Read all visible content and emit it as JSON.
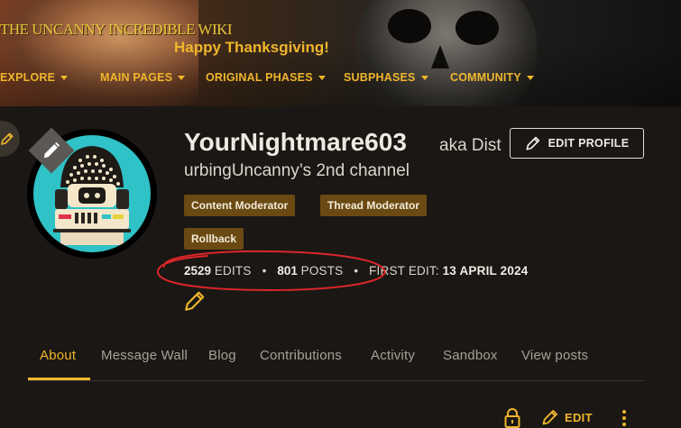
{
  "header": {
    "wiki_name": "THE UNCANNY INCREDIBLE WIKI",
    "tagline": "Happy Thanksgiving!",
    "nav": [
      {
        "label": "EXPLORE",
        "icon": "chevron-down-icon"
      },
      {
        "label": "MAIN PAGES",
        "icon": "chevron-down-icon"
      },
      {
        "label": "ORIGINAL PHASES",
        "icon": "chevron-down-icon"
      },
      {
        "label": "SUBPHASES",
        "icon": "chevron-down-icon"
      },
      {
        "label": "COMMUNITY",
        "icon": "chevron-down-icon"
      }
    ]
  },
  "profile": {
    "username": "YourNightmare603",
    "aka_prefix": "aka Dist",
    "aka_rest": "urbingUncanny’s 2nd channel",
    "edit_profile_label": "EDIT PROFILE",
    "badges": [
      "Content Moderator",
      "Thread Moderator",
      "Rollback"
    ],
    "stats": {
      "edits_count": "2529",
      "edits_label": "EDITS",
      "posts_count": "801",
      "posts_label": "POSTS",
      "first_edit_label": "FIRST EDIT:",
      "first_edit_date": "13 APRIL 2024",
      "separator": "•"
    }
  },
  "tabs": [
    {
      "label": "About",
      "active": true
    },
    {
      "label": "Message Wall",
      "active": false
    },
    {
      "label": "Blog",
      "active": false
    },
    {
      "label": "Contributions",
      "active": false
    },
    {
      "label": "Activity",
      "active": false
    },
    {
      "label": "Sandbox",
      "active": false
    },
    {
      "label": "View posts",
      "active": false
    }
  ],
  "toolbar": {
    "edit_label": "EDIT",
    "icons": [
      "lock-icon",
      "pencil-icon",
      "more-vertical-icon"
    ]
  },
  "colors": {
    "accent": "#f0b62c",
    "badge_bg": "#6a4a12",
    "background": "#1a1714",
    "avatar_bg": "#2fc2c6",
    "annotation_red": "#d9262b"
  }
}
